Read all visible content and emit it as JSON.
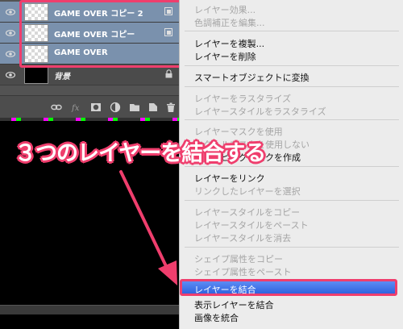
{
  "layers": [
    {
      "name": "GAME OVER コピー 2",
      "selected": true,
      "thumb": "transparent",
      "badge": "smart-object-icon"
    },
    {
      "name": "GAME OVER コピー",
      "selected": true,
      "thumb": "transparent",
      "badge": "smart-object-icon"
    },
    {
      "name": "GAME OVER",
      "selected": true,
      "thumb": "transparent",
      "badge": ""
    },
    {
      "name": "背景",
      "selected": false,
      "thumb": "black",
      "badge": "lock-icon"
    }
  ],
  "menu": {
    "items": [
      {
        "label": "レイヤー効果...",
        "enabled": false
      },
      {
        "label": "色調補正を編集...",
        "enabled": false
      },
      {
        "label": "レイヤーを複製...",
        "enabled": true
      },
      {
        "label": "レイヤーを削除",
        "enabled": true
      },
      {
        "label": "スマートオブジェクトに変換",
        "enabled": true
      },
      {
        "label": "レイヤーをラスタライズ",
        "enabled": false
      },
      {
        "label": "レイヤースタイルをラスタライズ",
        "enabled": false
      },
      {
        "label": "レイヤーマスクを使用",
        "enabled": false
      },
      {
        "label": "ベクトルマスクを使用しない",
        "enabled": false
      },
      {
        "label": "クリッピングマスクを作成",
        "enabled": true
      },
      {
        "label": "レイヤーをリンク",
        "enabled": true
      },
      {
        "label": "リンクしたレイヤーを選択",
        "enabled": false
      },
      {
        "label": "レイヤースタイルをコピー",
        "enabled": false
      },
      {
        "label": "レイヤースタイルをペースト",
        "enabled": false
      },
      {
        "label": "レイヤースタイルを消去",
        "enabled": false
      },
      {
        "label": "シェイプ属性をコピー",
        "enabled": false
      },
      {
        "label": "シェイプ属性をペースト",
        "enabled": false
      },
      {
        "label": "レイヤーを結合",
        "enabled": true,
        "highlighted": true
      },
      {
        "label": "表示レイヤーを結合",
        "enabled": true
      },
      {
        "label": "画像を統合",
        "enabled": true
      }
    ]
  },
  "annotation": {
    "text": "３つのレイヤーを結合する",
    "color": "#ef3e6d"
  },
  "colors": {
    "panel_bg": "#535353",
    "selected_layer": "#7a91ad",
    "menu_bg": "#ececec",
    "menu_highlight": "#3a6fe6",
    "accent_pink": "#ef3e6d"
  }
}
